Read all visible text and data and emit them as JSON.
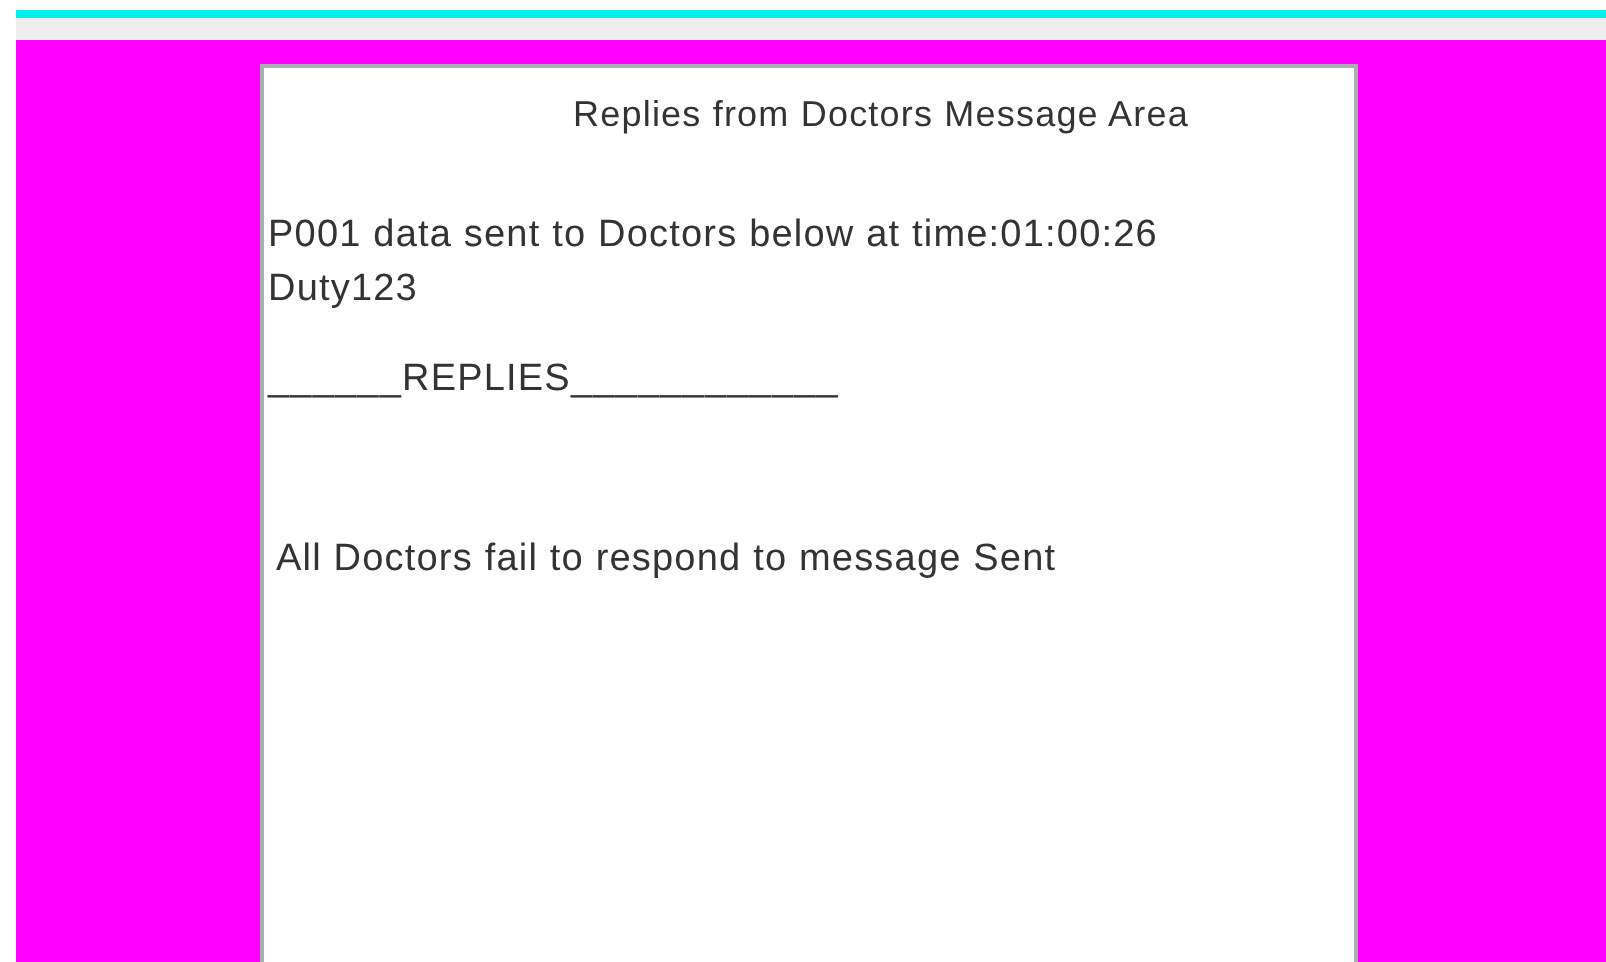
{
  "message_area": {
    "title": "Replies from Doctors Message Area",
    "paragraphs": [
      [
        "P001 data sent to Doctors below at time:01:00:26",
        "Duty123"
      ],
      [
        "______REPLIES____________"
      ],
      [
        "All Doctors fail to respond to message Sent"
      ]
    ]
  }
}
